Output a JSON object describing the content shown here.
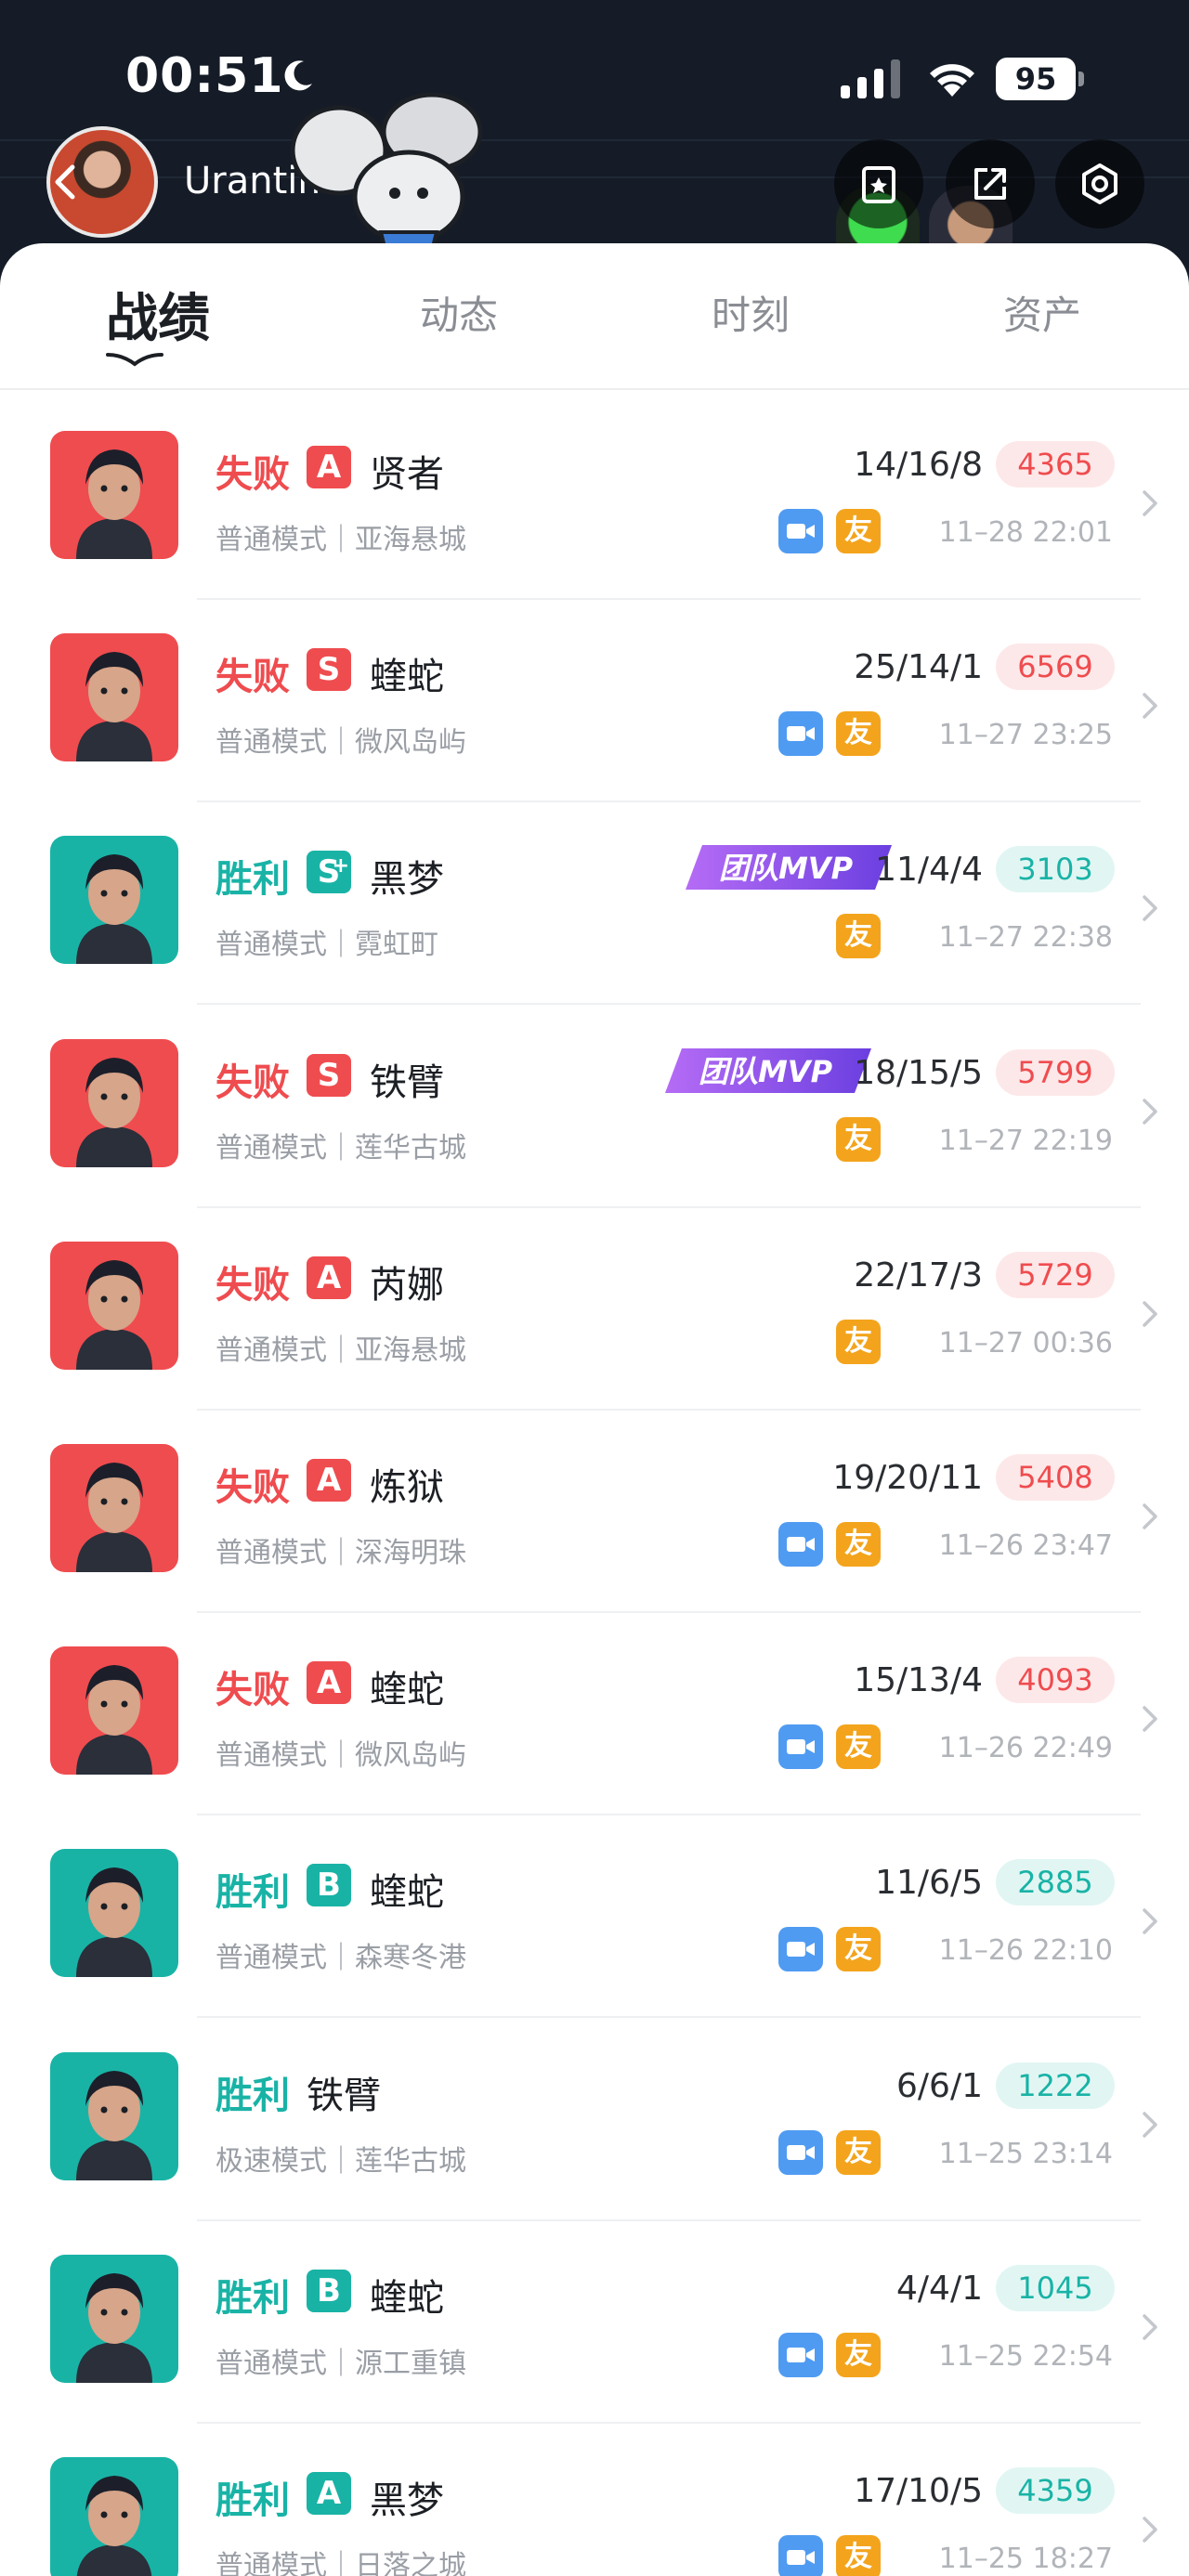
{
  "status_bar": {
    "time": "00:51",
    "battery": "95"
  },
  "profile": {
    "username": "Urantimony"
  },
  "header_icons": [
    "card-icon",
    "share-icon",
    "settings-hex-icon"
  ],
  "tabs": [
    {
      "label": "战绩",
      "active": true
    },
    {
      "label": "动态",
      "active": false
    },
    {
      "label": "时刻",
      "active": false
    },
    {
      "label": "资产",
      "active": false
    }
  ],
  "matches": [
    {
      "result": "失败",
      "outcome": "lose",
      "grade": "A",
      "agent": "贤者",
      "mode": "普通模式｜亚海悬城",
      "kda": "14/16/8",
      "score": "4365",
      "mvp": "",
      "video": true,
      "friend": "友",
      "date": "11–28 22:01",
      "portrait_color": "#ef4c4f",
      "portrait_icon": "agent-sage-portrait"
    },
    {
      "result": "失败",
      "outcome": "lose",
      "grade": "S",
      "agent": "蝰蛇",
      "mode": "普通模式｜微风岛屿",
      "kda": "25/14/1",
      "score": "6569",
      "mvp": "",
      "video": true,
      "friend": "友",
      "date": "11–27 23:25",
      "portrait_color": "#ef4c4f",
      "portrait_icon": "agent-viper-portrait"
    },
    {
      "result": "胜利",
      "outcome": "win",
      "grade": "S",
      "grade_plus": "+",
      "agent": "黑梦",
      "mode": "普通模式｜霓虹町",
      "kda": "11/4/4",
      "score": "3103",
      "mvp": "团队MVP",
      "video": false,
      "friend": "友",
      "date": "11–27 22:38",
      "portrait_color": "#19b3a6",
      "portrait_icon": "agent-reyna-portrait"
    },
    {
      "result": "失败",
      "outcome": "lose",
      "grade": "S",
      "agent": "铁臂",
      "mode": "普通模式｜莲华古城",
      "kda": "18/15/5",
      "score": "5799",
      "mvp": "团队MVP",
      "video": false,
      "friend": "友",
      "date": "11–27 22:19",
      "portrait_color": "#ef4c4f",
      "portrait_icon": "agent-breach-portrait"
    },
    {
      "result": "失败",
      "outcome": "lose",
      "grade": "A",
      "agent": "芮娜",
      "mode": "普通模式｜亚海悬城",
      "kda": "22/17/3",
      "score": "5729",
      "mvp": "",
      "video": false,
      "friend": "友",
      "date": "11–27 00:36",
      "portrait_color": "#ef4c4f",
      "portrait_icon": "agent-reyna2-portrait"
    },
    {
      "result": "失败",
      "outcome": "lose",
      "grade": "A",
      "agent": "炼狱",
      "mode": "普通模式｜深海明珠",
      "kda": "19/20/11",
      "score": "5408",
      "mvp": "",
      "video": true,
      "friend": "友",
      "date": "11–26 23:47",
      "portrait_color": "#ef4c4f",
      "portrait_icon": "agent-brimstone-portrait"
    },
    {
      "result": "失败",
      "outcome": "lose",
      "grade": "A",
      "agent": "蝰蛇",
      "mode": "普通模式｜微风岛屿",
      "kda": "15/13/4",
      "score": "4093",
      "mvp": "",
      "video": true,
      "friend": "友",
      "date": "11–26 22:49",
      "portrait_color": "#ef4c4f",
      "portrait_icon": "agent-viper-portrait"
    },
    {
      "result": "胜利",
      "outcome": "win",
      "grade": "B",
      "agent": "蝰蛇",
      "mode": "普通模式｜森寒冬港",
      "kda": "11/6/5",
      "score": "2885",
      "mvp": "",
      "video": true,
      "friend": "友",
      "date": "11–26 22:10",
      "portrait_color": "#19b3a6",
      "portrait_icon": "agent-viper-portrait"
    },
    {
      "result": "胜利",
      "outcome": "win",
      "grade": "",
      "agent": "铁臂",
      "mode": "极速模式｜莲华古城",
      "kda": "6/6/1",
      "score": "1222",
      "mvp": "",
      "video": true,
      "friend": "友",
      "date": "11–25 23:14",
      "portrait_color": "#19b3a6",
      "portrait_icon": "agent-breach-portrait"
    },
    {
      "result": "胜利",
      "outcome": "win",
      "grade": "B",
      "agent": "蝰蛇",
      "mode": "普通模式｜源工重镇",
      "kda": "4/4/1",
      "score": "1045",
      "mvp": "",
      "video": true,
      "friend": "友",
      "date": "11–25 22:54",
      "portrait_color": "#19b3a6",
      "portrait_icon": "agent-viper-portrait"
    },
    {
      "result": "胜利",
      "outcome": "win",
      "grade": "A",
      "agent": "黑梦",
      "mode": "普通模式｜日落之城",
      "kda": "17/10/5",
      "score": "4359",
      "mvp": "",
      "video": true,
      "friend": "友",
      "date": "11–25 18:27",
      "portrait_color": "#19b3a6",
      "portrait_icon": "agent-reyna-portrait"
    }
  ]
}
